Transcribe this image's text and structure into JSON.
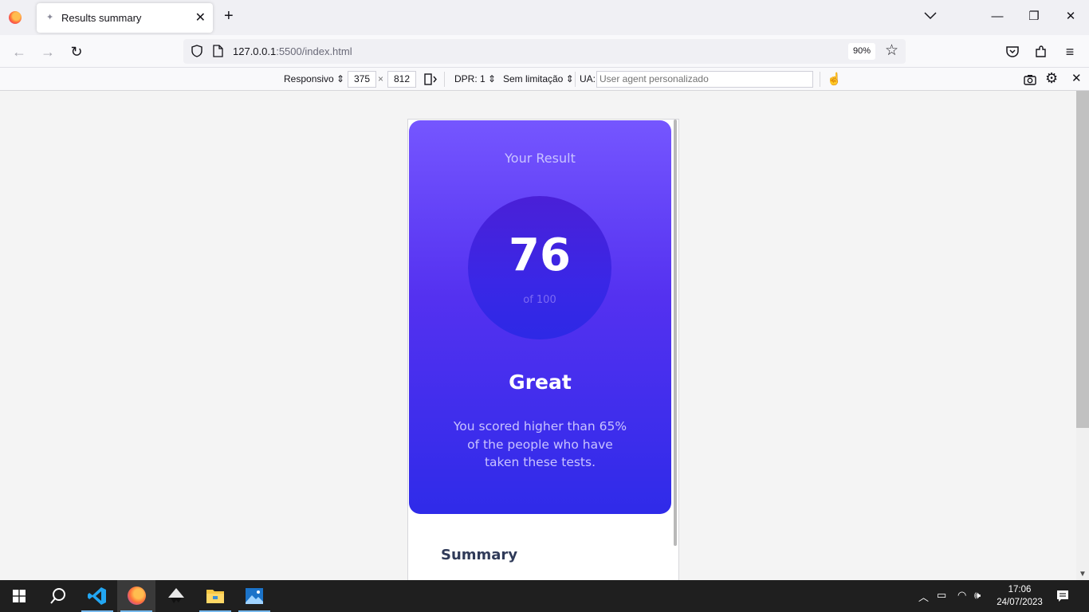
{
  "browser": {
    "tab": {
      "title": "Results summary"
    },
    "url": {
      "host": "127.0.0.1",
      "path": ":5500/index.html"
    },
    "zoom": "90%"
  },
  "responsive_toolbar": {
    "device_label": "Responsivo",
    "width": "375",
    "times": "×",
    "height": "812",
    "dpr": "DPR: 1",
    "throttle": "Sem limitação",
    "ua_label": "UA:",
    "ua_placeholder": "User agent personalizado"
  },
  "page": {
    "your_result": "Your Result",
    "score": "76",
    "of_total": "of 100",
    "grade": "Great",
    "description": "You scored higher than 65% of the people who have taken these tests.",
    "summary_title": "Summary"
  },
  "taskbar": {
    "time": "17:06",
    "date": "24/07/2023"
  }
}
